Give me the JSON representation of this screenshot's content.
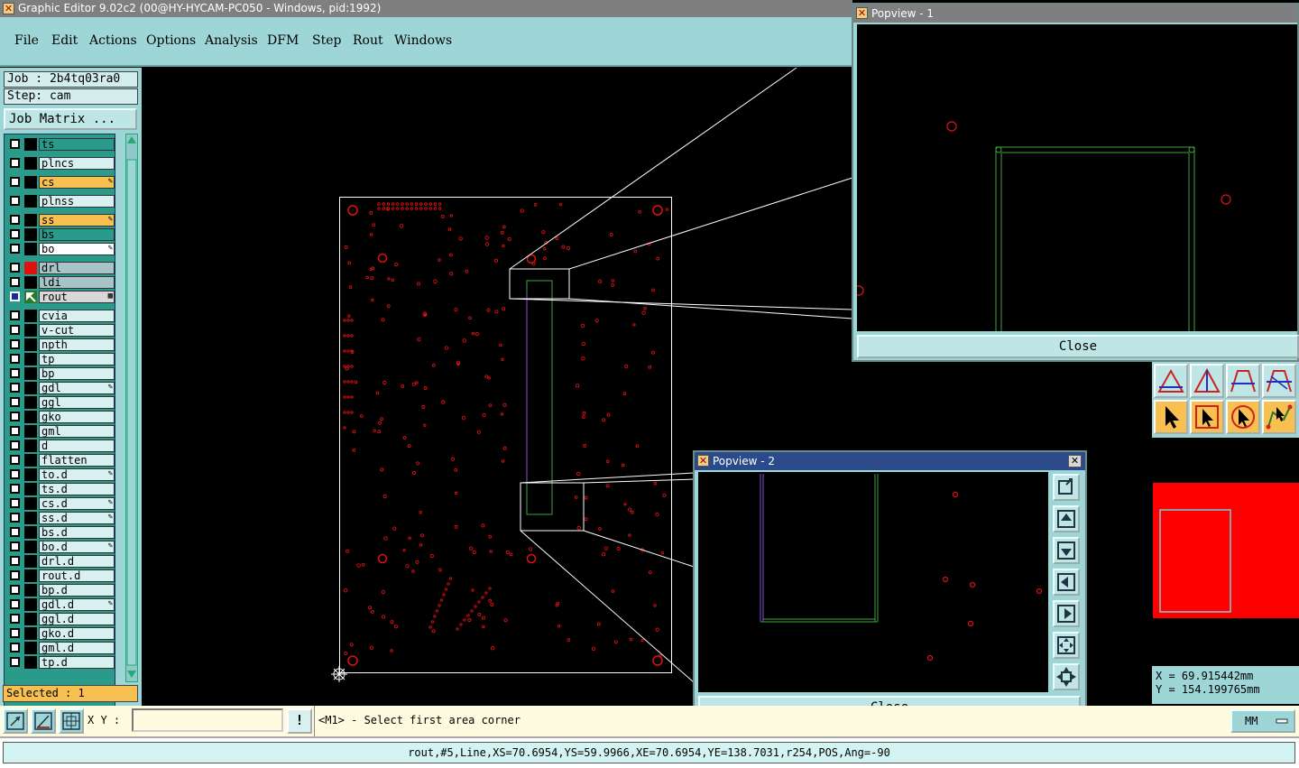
{
  "window": {
    "title": "Graphic Editor 9.02c2 (00@HY-HYCAM-PC050 - Windows, pid:1992)"
  },
  "menu": [
    "File",
    "Edit",
    "Actions",
    "Options",
    "Analysis",
    "DFM",
    "Step",
    "Rout",
    "Windows"
  ],
  "job": {
    "job_label": "Job : 2b4tq03ra0",
    "step_label": "Step: cam",
    "matrix_button": "Job Matrix ..."
  },
  "layers": [
    {
      "name": "ts",
      "bg": "#2a9a8a",
      "swatch": "#000",
      "flag": ""
    },
    {
      "name": "plncs",
      "bg": "#d8f0f0",
      "swatch": "#000",
      "flag": ""
    },
    {
      "name": "cs",
      "bg": "#f8c050",
      "swatch": "#000",
      "flag": "✎"
    },
    {
      "name": "plnss",
      "bg": "#d8f0f0",
      "swatch": "#000",
      "flag": ""
    },
    {
      "name": "ss",
      "bg": "#f8c050",
      "swatch": "#000",
      "flag": "✎"
    },
    {
      "name": "bs",
      "bg": "#2a9a8a",
      "swatch": "#000",
      "flag": ""
    },
    {
      "name": "bo",
      "bg": "#ffffff",
      "swatch": "#000",
      "flag": "✎"
    },
    {
      "name": "drl",
      "bg": "#a8c4c8",
      "swatch": "#e01010",
      "flag": ""
    },
    {
      "name": "ldi",
      "bg": "#a8c4c8",
      "swatch": "#000",
      "flag": ""
    },
    {
      "name": "rout",
      "bg": "#d8d8d8",
      "swatch": "#000",
      "flag": "▦"
    },
    {
      "name": "cvia",
      "bg": "#d8f0f0",
      "swatch": "#000",
      "flag": ""
    },
    {
      "name": "v-cut",
      "bg": "#d8f0f0",
      "swatch": "#000",
      "flag": ""
    },
    {
      "name": "npth",
      "bg": "#d8f0f0",
      "swatch": "#000",
      "flag": ""
    },
    {
      "name": "tp",
      "bg": "#d8f0f0",
      "swatch": "#000",
      "flag": ""
    },
    {
      "name": "bp",
      "bg": "#d8f0f0",
      "swatch": "#000",
      "flag": ""
    },
    {
      "name": "gdl",
      "bg": "#d8f0f0",
      "swatch": "#000",
      "flag": "✎"
    },
    {
      "name": "ggl",
      "bg": "#d8f0f0",
      "swatch": "#000",
      "flag": ""
    },
    {
      "name": "gko",
      "bg": "#d8f0f0",
      "swatch": "#000",
      "flag": ""
    },
    {
      "name": "gml",
      "bg": "#d8f0f0",
      "swatch": "#000",
      "flag": ""
    },
    {
      "name": "d",
      "bg": "#d8f0f0",
      "swatch": "#000",
      "flag": ""
    },
    {
      "name": "flatten",
      "bg": "#d8f0f0",
      "swatch": "#000",
      "flag": ""
    },
    {
      "name": "to.d",
      "bg": "#d8f0f0",
      "swatch": "#000",
      "flag": "✎"
    },
    {
      "name": "ts.d",
      "bg": "#d8f0f0",
      "swatch": "#000",
      "flag": ""
    },
    {
      "name": "cs.d",
      "bg": "#d8f0f0",
      "swatch": "#000",
      "flag": "✎"
    },
    {
      "name": "ss.d",
      "bg": "#d8f0f0",
      "swatch": "#000",
      "flag": "✎"
    },
    {
      "name": "bs.d",
      "bg": "#d8f0f0",
      "swatch": "#000",
      "flag": ""
    },
    {
      "name": "bo.d",
      "bg": "#d8f0f0",
      "swatch": "#000",
      "flag": "✎"
    },
    {
      "name": "drl.d",
      "bg": "#d8f0f0",
      "swatch": "#000",
      "flag": ""
    },
    {
      "name": "rout.d",
      "bg": "#d8f0f0",
      "swatch": "#000",
      "flag": ""
    },
    {
      "name": "bp.d",
      "bg": "#d8f0f0",
      "swatch": "#000",
      "flag": ""
    },
    {
      "name": "gdl.d",
      "bg": "#d8f0f0",
      "swatch": "#000",
      "flag": "✎"
    },
    {
      "name": "ggl.d",
      "bg": "#d8f0f0",
      "swatch": "#000",
      "flag": ""
    },
    {
      "name": "gko.d",
      "bg": "#d8f0f0",
      "swatch": "#000",
      "flag": ""
    },
    {
      "name": "gml.d",
      "bg": "#d8f0f0",
      "swatch": "#000",
      "flag": ""
    },
    {
      "name": "tp.d",
      "bg": "#d8f0f0",
      "swatch": "#000",
      "flag": ""
    }
  ],
  "selected_label": "Selected : 1",
  "popview1": {
    "title": "Popview - 1",
    "close_label": "Close"
  },
  "popview2": {
    "title": "Popview - 2",
    "close_label": "Close"
  },
  "coords": {
    "x_label": "X = 69.915442mm",
    "y_label": "Y = 154.199765mm"
  },
  "xy": {
    "label": "X Y :",
    "value": ""
  },
  "warn_label": "!",
  "prompt_text": "<M1> - Select first area corner",
  "units": {
    "selected": "MM"
  },
  "status_text": "rout,#5,Line,XS=70.6954,YS=59.9966,XE=70.6954,YE=138.7031,r254,POS,Ang=-90",
  "colors": {
    "panel": "#9ed6d8",
    "pad_red": "#e01010",
    "rout_green": "#3fa33f",
    "profile_white": "#ffffff",
    "active_title": "#2a4a8a"
  }
}
